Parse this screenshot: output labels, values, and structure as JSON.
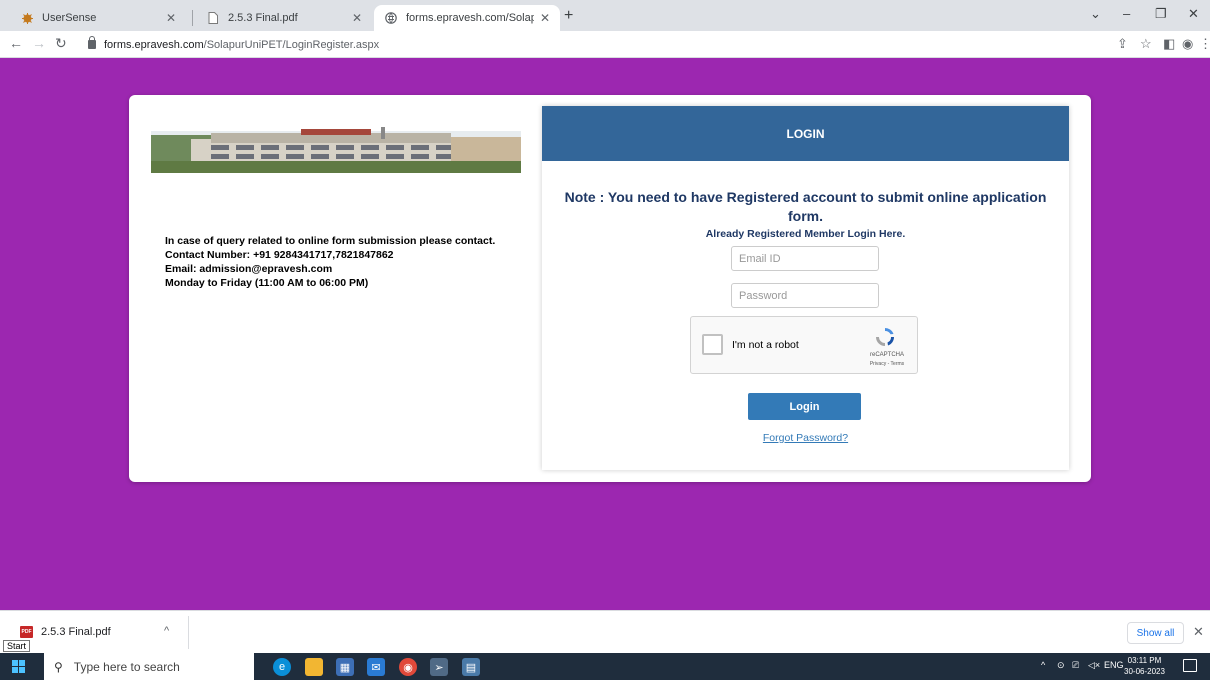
{
  "browser": {
    "tabs": [
      {
        "title": "UserSense",
        "icon": "usersense-favicon",
        "active": false
      },
      {
        "title": "2.5.3 Final.pdf",
        "icon": "pdf-file-icon",
        "active": false
      },
      {
        "title": "forms.epravesh.com/SolapurUni",
        "icon": "globe-icon",
        "active": true
      }
    ],
    "url_host": "forms.epravesh.com",
    "url_path": "/SolapurUniPET/LoginRegister.aspx"
  },
  "page": {
    "background_color": "#9c27b0",
    "contact": {
      "line1": "In case of query related to online form submission please contact.",
      "line2": "Contact Number: +91 9284341717,7821847862",
      "line3": "Email: admission@epravesh.com",
      "line4": "Monday to Friday (11:00 AM to 06:00 PM)"
    },
    "login": {
      "header": "LOGIN",
      "header_color": "#336699",
      "note": "Note : You need to have Registered account to submit online application form.",
      "already": "Already Registered Member Login Here.",
      "email_placeholder": "Email ID",
      "password_placeholder": "Password",
      "captcha_label": "I'm not a robot",
      "captcha_brand": "reCAPTCHA",
      "captcha_terms": "Privacy - Terms",
      "button": "Login",
      "forgot": "Forgot Password?"
    }
  },
  "downloads": {
    "file": "2.5.3 Final.pdf",
    "file_icon_text": "PDF",
    "show_all": "Show all"
  },
  "taskbar": {
    "start_tooltip": "Start",
    "search_placeholder": "Type here to search",
    "lang": "ENG",
    "time": "03:11 PM",
    "date": "30-06-2023"
  }
}
